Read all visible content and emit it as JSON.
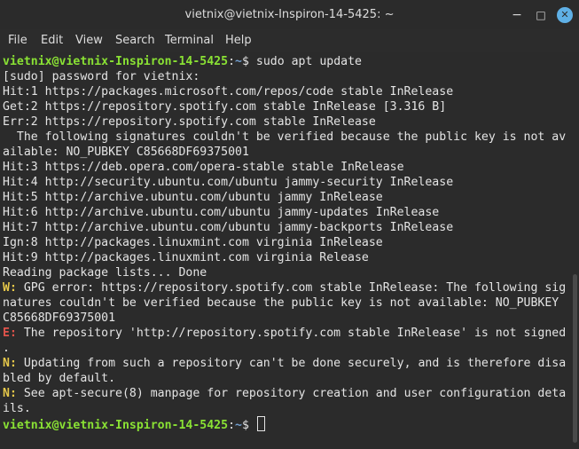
{
  "window": {
    "title": "vietnix@vietnix-Inspiron-14-5425: ~",
    "controls": {
      "minimize": "−",
      "maximize": "□",
      "close": "✕"
    }
  },
  "menu": [
    "File",
    "Edit",
    "View",
    "Search",
    "Terminal",
    "Help"
  ],
  "prompt": {
    "user_host": "vietnix@vietnix-Inspiron-14-5425",
    "colon": ":",
    "path": "~",
    "symbol": "$ "
  },
  "command": "sudo apt update",
  "output": [
    "[sudo] password for vietnix:",
    "Hit:1 https://packages.microsoft.com/repos/code stable InRelease",
    "Get:2 https://repository.spotify.com stable InRelease [3.316 B]",
    "Err:2 https://repository.spotify.com stable InRelease",
    "  The following signatures couldn't be verified because the public key is not av",
    "ailable: NO_PUBKEY C85668DF69375001",
    "Hit:3 https://deb.opera.com/opera-stable stable InRelease",
    "Hit:4 http://security.ubuntu.com/ubuntu jammy-security InRelease",
    "Hit:5 http://archive.ubuntu.com/ubuntu jammy InRelease",
    "Hit:6 http://archive.ubuntu.com/ubuntu jammy-updates InRelease",
    "Hit:7 http://archive.ubuntu.com/ubuntu jammy-backports InRelease",
    "Ign:8 http://packages.linuxmint.com virginia InRelease",
    "Hit:9 http://packages.linuxmint.com virginia Release",
    "Reading package lists... Done"
  ],
  "messages": {
    "w_tag": "W:",
    "w_line1": " GPG error: https://repository.spotify.com stable InRelease: The following sig",
    "w_line2": "natures couldn't be verified because the public key is not available: NO_PUBKEY",
    "w_line3": "C85668DF69375001",
    "e_tag": "E:",
    "e_line1": " The repository 'http://repository.spotify.com stable InRelease' is not signed",
    "e_line2": ".",
    "n1_tag": "N:",
    "n1_line1": " Updating from such a repository can't be done securely, and is therefore disa",
    "n1_line2": "bled by default.",
    "n2_tag": "N:",
    "n2_line1": " See apt-secure(8) manpage for repository creation and user configuration deta",
    "n2_line2": "ils."
  },
  "colors": {
    "background": "#2b2b2b",
    "prompt_user": "#8ae234",
    "prompt_path": "#729fcf",
    "warning": "#e6c84a",
    "error": "#e0534b",
    "close_button": "#5fb0e6"
  }
}
